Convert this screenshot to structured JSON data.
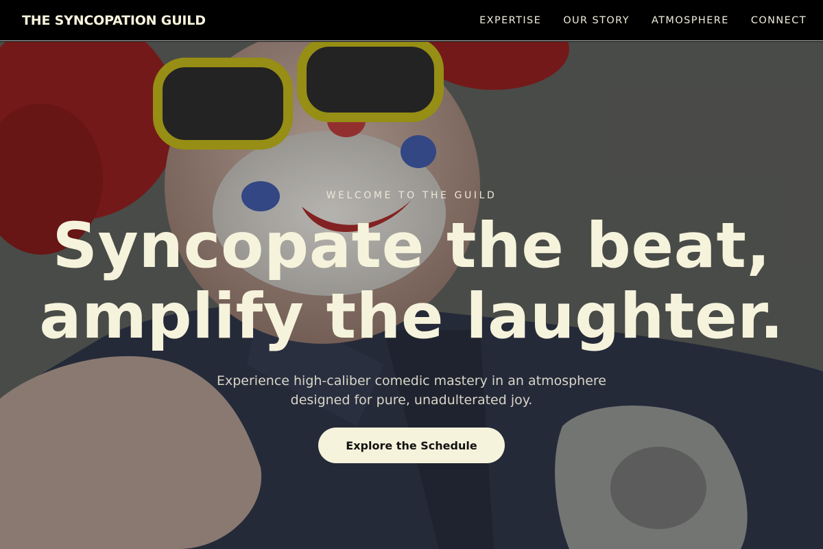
{
  "nav": {
    "brand": "THE SYNCOPATION GUILD",
    "links": [
      {
        "label": "EXPERTISE"
      },
      {
        "label": "OUR STORY"
      },
      {
        "label": "ATMOSPHERE"
      },
      {
        "label": "CONNECT"
      }
    ]
  },
  "hero": {
    "eyebrow": "WELCOME TO THE GUILD",
    "headline_line1": "Syncopate the beat,",
    "headline_line2": "amplify the laughter.",
    "subhead_line1": "Experience high-caliber comedic mastery in an atmosphere",
    "subhead_line2": "designed for pure, unadulterated joy.",
    "cta_label": "Explore the Schedule"
  },
  "colors": {
    "nav_bg": "#000000",
    "accent_cream": "#f6f3dc"
  }
}
